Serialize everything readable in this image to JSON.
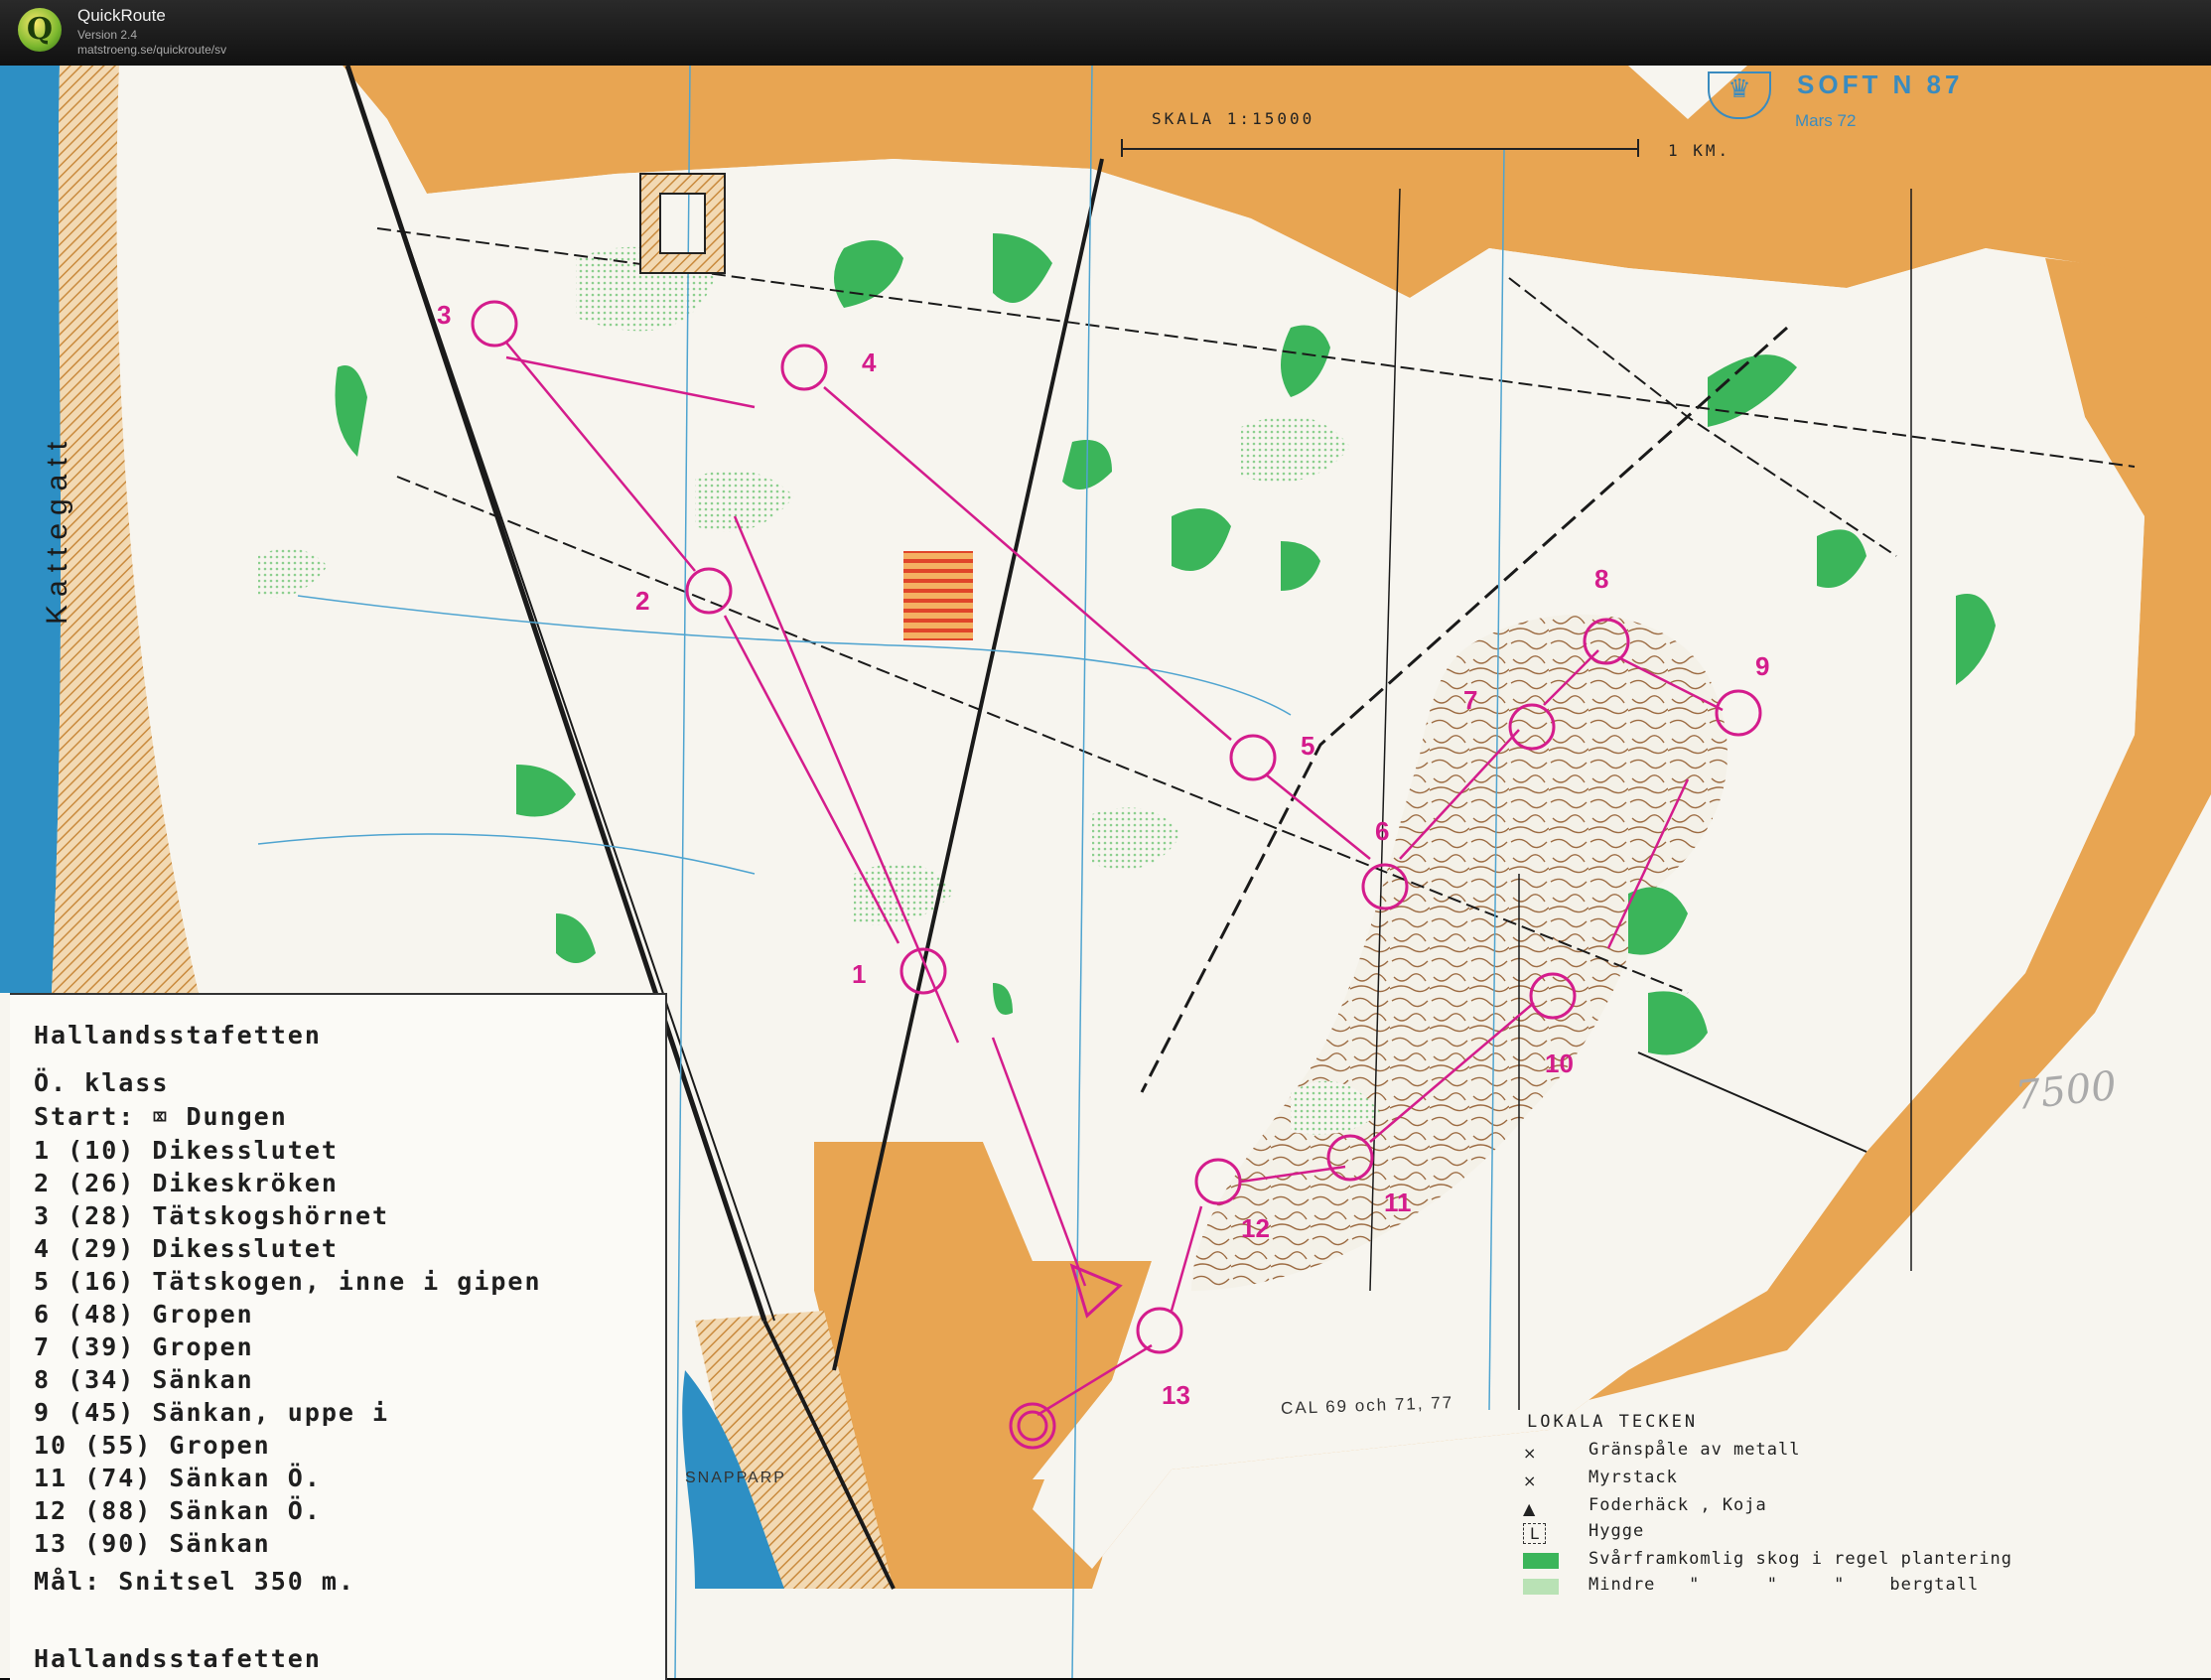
{
  "app": {
    "name": "QuickRoute",
    "version": "Version 2.4",
    "url": "matstroeng.se/quickroute/sv"
  },
  "map": {
    "scale_label": "SKALA  1:15000",
    "scale_bar_label": "1 KM.",
    "publisher": "SOFT  N 87",
    "date": "Mars 72",
    "place_water": "Kattegatt",
    "place_town": "SNAPPARP",
    "survey_note": "CAL 69 och 71, 77",
    "handwritten_note": "7500",
    "colors": {
      "open_land": "#e8a552",
      "forest_green": "#3bb55a",
      "water": "#2d8fc4",
      "course_magenta": "#d41c8c"
    }
  },
  "course": {
    "title": "Hallandsstafetten",
    "class_label": "Ö. klass",
    "start_line": "Start: ⌧ Dungen",
    "controls": [
      {
        "line": "1 (10) Dikesslutet",
        "number": "1"
      },
      {
        "line": "2 (26) Dikeskröken",
        "number": "2"
      },
      {
        "line": "3 (28) Tätskogshörnet",
        "number": "3"
      },
      {
        "line": "4 (29) Dikesslutet",
        "number": "4"
      },
      {
        "line": "5 (16) Tätskogen, inne i gipen",
        "number": "5"
      },
      {
        "line": "6 (48) Gropen",
        "number": "6"
      },
      {
        "line": "7 (39) Gropen",
        "number": "7"
      },
      {
        "line": "8 (34) Sänkan",
        "number": "8"
      },
      {
        "line": "9 (45) Sänkan, uppe i",
        "number": "9"
      },
      {
        "line": "10 (55) Gropen",
        "number": "10"
      },
      {
        "line": "11 (74) Sänkan Ö.",
        "number": "11"
      },
      {
        "line": "12 (88) Sänkan Ö.",
        "number": "12"
      },
      {
        "line": "13 (90) Sänkan",
        "number": "13"
      }
    ],
    "finish_line": "Mål: Snitsel 350 m.",
    "footer_title": "Hallandsstafetten"
  },
  "legend": {
    "title": "LOKALA TECKEN",
    "items": [
      {
        "symbol": "×",
        "label": "Gränspåle av metall"
      },
      {
        "symbol": "×",
        "label": "Myrstack"
      },
      {
        "symbol": "▲",
        "label": "Foderhäck , Koja"
      },
      {
        "symbol": "L",
        "label": "Hygge"
      },
      {
        "symbol": "green-swatch",
        "label": "Svårframkomlig skog i regel plantering"
      },
      {
        "symbol": "light-green-swatch",
        "label": "Mindre   \"      \"     \"    bergtall"
      }
    ]
  }
}
